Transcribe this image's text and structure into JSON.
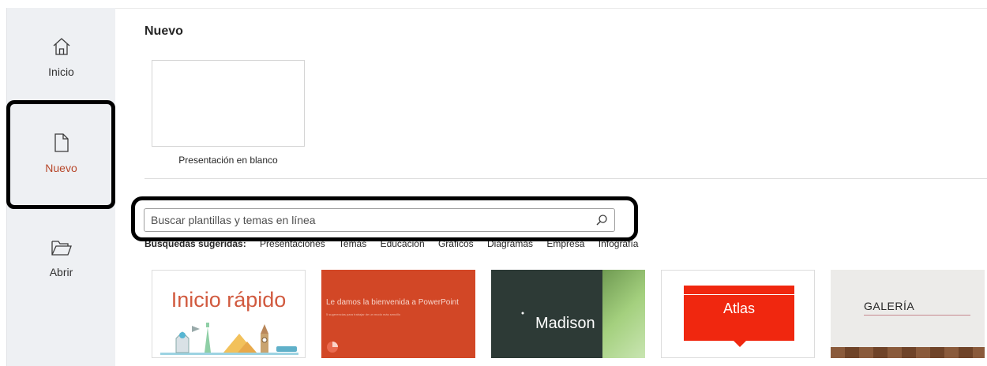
{
  "sidebar": {
    "items": [
      {
        "label": "Inicio",
        "icon": "home-icon"
      },
      {
        "label": "Nuevo",
        "icon": "new-document-icon",
        "active": true
      },
      {
        "label": "Abrir",
        "icon": "folder-open-icon"
      }
    ]
  },
  "main": {
    "title": "Nuevo",
    "blank_template_label": "Presentación en blanco",
    "search": {
      "placeholder": "Buscar plantillas y temas en línea",
      "icon": "search-icon"
    },
    "suggested": {
      "label": "Búsquedas sugeridas:",
      "items": [
        "Presentaciones",
        "Temas",
        "Educación",
        "Gráficos",
        "Diagramas",
        "Empresa",
        "Infografía"
      ]
    },
    "templates": [
      {
        "title": "Inicio rápido"
      },
      {
        "title": "Le damos la bienvenida a PowerPoint",
        "subtitle": "5 sugerencias para trabajar de un modo más sencillo"
      },
      {
        "title": "Madison"
      },
      {
        "title": "Atlas"
      },
      {
        "title": "GALERÍA"
      }
    ]
  },
  "colors": {
    "accent": "#b7472a",
    "sidebar_bg": "#eef0f3",
    "highlight_border": "#000000"
  }
}
